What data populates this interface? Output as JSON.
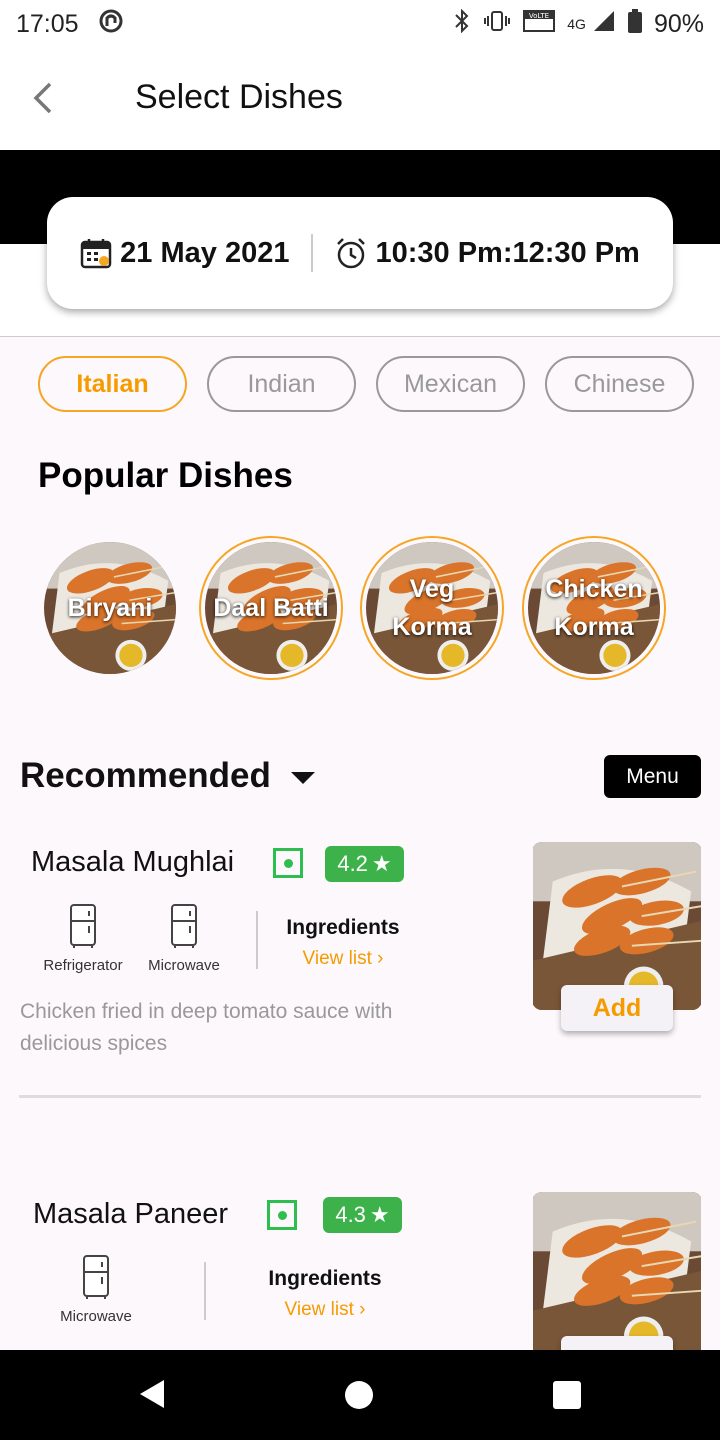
{
  "status_bar": {
    "time": "17:05",
    "network": "4G",
    "battery": "90%",
    "volte": "VoLTE"
  },
  "header": {
    "title": "Select Dishes"
  },
  "booking": {
    "date": "21 May 2021",
    "time_range": "10:30 Pm:12:30 Pm"
  },
  "cuisines": [
    {
      "label": "Italian",
      "active": true
    },
    {
      "label": "Indian",
      "active": false
    },
    {
      "label": "Mexican",
      "active": false
    },
    {
      "label": "Chinese",
      "active": false
    }
  ],
  "popular": {
    "title": "Popular Dishes",
    "dishes": [
      {
        "name": "Biryani"
      },
      {
        "name": "Daal Batti"
      },
      {
        "name": "Veg Korma"
      },
      {
        "name": "Chicken Korma"
      }
    ]
  },
  "recommended": {
    "title": "Recommended",
    "menu_label": "Menu",
    "items": [
      {
        "name": "Masala Mughlai",
        "rating": "4.2",
        "appliances": [
          "Refrigerator",
          "Microwave"
        ],
        "ingredients_label": "Ingredients",
        "view_list_label": "View list",
        "description": "Chicken fried in deep tomato sauce with delicious spices",
        "add_label": "Add"
      },
      {
        "name": "Masala Paneer",
        "rating": "4.3",
        "appliances": [
          "Microwave"
        ],
        "ingredients_label": "Ingredients",
        "view_list_label": "View list"
      }
    ]
  },
  "colors": {
    "accent": "#f59b00",
    "veg_green": "#2ebd4f",
    "rating_green": "#3db24a"
  }
}
